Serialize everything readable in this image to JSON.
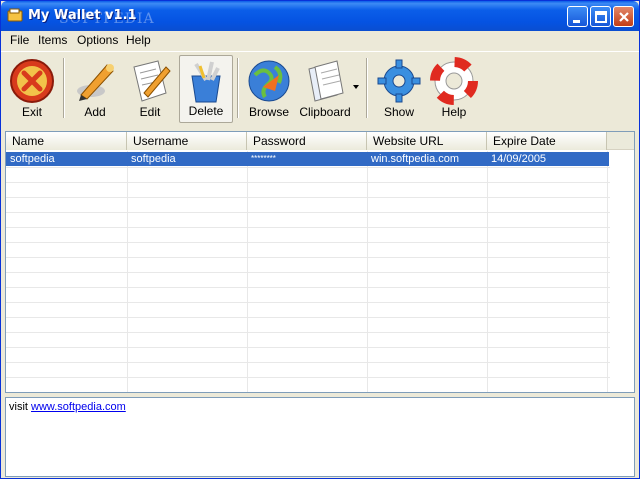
{
  "window": {
    "title": "My Wallet v1.1",
    "watermark": "SOFTPEDIA"
  },
  "menu": [
    "File",
    "Items",
    "Options",
    "Help"
  ],
  "toolbar": {
    "exit": "Exit",
    "add": "Add",
    "edit": "Edit",
    "delete": "Delete",
    "browse": "Browse",
    "clipboard": "Clipboard",
    "show": "Show",
    "help": "Help"
  },
  "table": {
    "columns": [
      "Name",
      "Username",
      "Password",
      "Website URL",
      "Expire Date"
    ],
    "rows": [
      [
        "softpedia",
        "softpedia",
        "********",
        "win.softpedia.com",
        "14/09/2005"
      ]
    ]
  },
  "info": {
    "prefix": "visit",
    "link": "www.softpedia.com"
  },
  "colors": {
    "titlebar": "#0553e2",
    "selection": "#316ac5"
  }
}
